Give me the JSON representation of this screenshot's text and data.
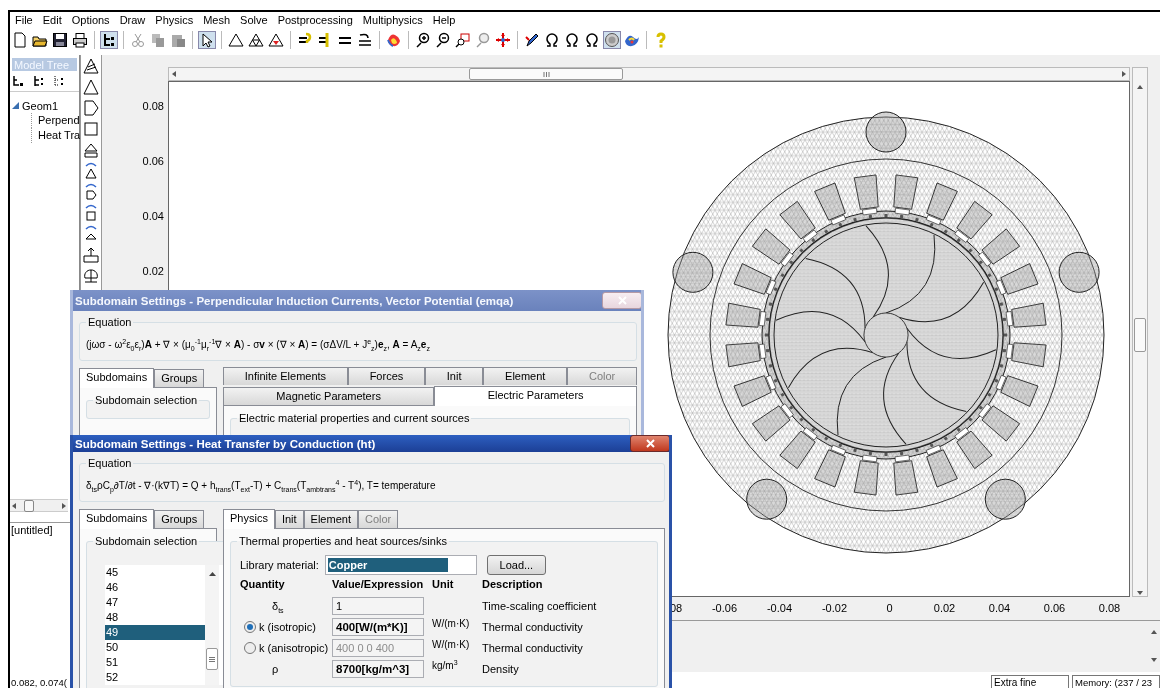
{
  "menu": [
    "File",
    "Edit",
    "Options",
    "Draw",
    "Physics",
    "Mesh",
    "Solve",
    "Postprocessing",
    "Multiphysics",
    "Help"
  ],
  "model_tree": {
    "title": "Model Tree",
    "items": [
      {
        "label": "Geom1",
        "expanded": true,
        "children": [
          {
            "label": "Perpend"
          },
          {
            "label": "Heat Tra"
          }
        ]
      }
    ]
  },
  "document_label": "[untitled]",
  "plot": {
    "y_ticks": [
      "0.08",
      "0.06",
      "0.04",
      "0.02"
    ],
    "x_ticks": [
      "08",
      "-0.06",
      "-0.04",
      "-0.02",
      "0",
      "0.02",
      "0.04",
      "0.06",
      "0.08"
    ]
  },
  "status_bar": {
    "coordinates": "0.082, 0.074(",
    "mesh_size": "Extra fine",
    "memory": "Memory: (237 / 23"
  },
  "dialogs": [
    {
      "title": "Subdomain Settings - Perpendicular Induction Currents, Vector Potential (emqa)",
      "active": false,
      "equation_label": "Equation",
      "equation": "(jωσ - ω$^{2}$ε$_{0}$ε$_{r}$)**A** + ∇ × (μ$_{0}$$^{-1}$μ$_{r}$$^{-1}$∇ × **A**) - σ**v** × (∇ × **A**) = (σΔV/L + J$^{e}$$_{z}$)**e**$_{z}$, **A** = A$_{z}$**e**$_{z}$",
      "left_tabs": [
        {
          "label": "Subdomains",
          "selected": true
        },
        {
          "label": "Groups",
          "selected": false
        }
      ],
      "selection_label": "Subdomain selection",
      "right_tab_rows": [
        [
          {
            "label": "Infinite Elements",
            "selected": false,
            "disabled": false
          },
          {
            "label": "Forces",
            "selected": false,
            "disabled": false
          },
          {
            "label": "Init",
            "selected": false,
            "disabled": false
          },
          {
            "label": "Element",
            "selected": false,
            "disabled": false
          },
          {
            "label": "Color",
            "selected": false,
            "disabled": true
          }
        ],
        [
          {
            "label": "Magnetic Parameters",
            "selected": false,
            "disabled": false
          },
          {
            "label": "Electric Parameters",
            "selected": true,
            "disabled": false
          }
        ]
      ],
      "group_label": "Electric material properties and current sources"
    },
    {
      "title": "Subdomain Settings - Heat Transfer by Conduction (ht)",
      "active": true,
      "equation_label": "Equation",
      "equation": "δ$_{ts}$ρC$_{p}$∂T/∂t - ∇·(k∇T) = Q + h$_{trans}$(T$_{ext}$-T) + C$_{trans}$(T$_{ambtrans}$$^{4}$ - T$^{4}$), T= temperature",
      "left_tabs": [
        {
          "label": "Subdomains",
          "selected": true
        },
        {
          "label": "Groups",
          "selected": false
        }
      ],
      "selection_label": "Subdomain selection",
      "subdomains": [
        {
          "label": "45",
          "selected": false
        },
        {
          "label": "46",
          "selected": false
        },
        {
          "label": "47",
          "selected": false
        },
        {
          "label": "48",
          "selected": false
        },
        {
          "label": "49",
          "selected": true
        },
        {
          "label": "50",
          "selected": false
        },
        {
          "label": "51",
          "selected": false
        },
        {
          "label": "52",
          "selected": false
        }
      ],
      "right_tab_rows": [
        [
          {
            "label": "Physics",
            "selected": true,
            "disabled": false
          },
          {
            "label": "Init",
            "selected": false,
            "disabled": false
          },
          {
            "label": "Element",
            "selected": false,
            "disabled": false
          },
          {
            "label": "Color",
            "selected": false,
            "disabled": true
          }
        ]
      ],
      "group_label": "Thermal properties and heat sources/sinks",
      "library_material": {
        "label": "Library material:",
        "value": "Copper",
        "highlighted": true
      },
      "load_button": "Load...",
      "table": {
        "columns": [
          "Quantity",
          "Value/Expression",
          "Unit",
          "Description"
        ],
        "rows": [
          {
            "kind": "plain",
            "quantity": "δ$_{ts}$",
            "value": "1",
            "bold": false,
            "disabled": false,
            "description": "Time-scaling coefficient"
          },
          {
            "kind": "radio",
            "checked": true,
            "quantity": "k (isotropic)",
            "value": "400[W/(m*K)]",
            "bold": true,
            "disabled": false,
            "unit": "W/(m·K)",
            "description": "Thermal conductivity"
          },
          {
            "kind": "radio",
            "checked": false,
            "quantity": "k (anisotropic)",
            "value": "400 0 0 400",
            "bold": false,
            "disabled": true,
            "unit": "W/(m·K)",
            "description": "Thermal conductivity"
          },
          {
            "kind": "plain",
            "quantity": "ρ",
            "value": "8700[kg/m^3]",
            "bold": true,
            "disabled": false,
            "unit": "kg/m$^{3}$",
            "description": "Density"
          }
        ]
      }
    }
  ]
}
